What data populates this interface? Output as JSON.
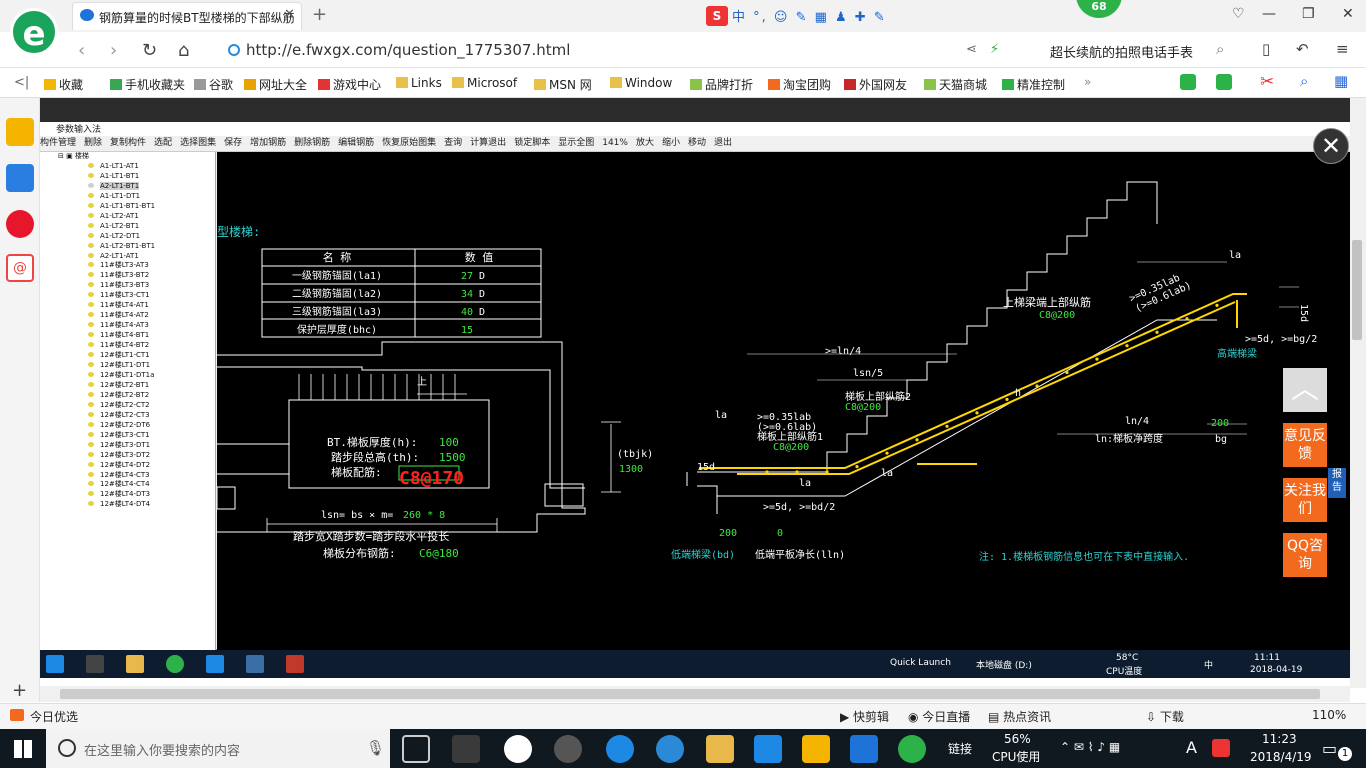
{
  "browser": {
    "tab_title": "钢筋算量的时候BT型楼梯的下部纵筋",
    "url": "http://e.fwxgx.com/question_1775307.html",
    "search_text": "超长续航的拍照电话手表",
    "notification_count": "68",
    "ime_text": "中 °,"
  },
  "bookmarks": [
    {
      "label": "收藏",
      "color": "#f2b705"
    },
    {
      "label": "手机收藏夹",
      "color": "#3aa655"
    },
    {
      "label": "谷歌",
      "color": "#999999"
    },
    {
      "label": "网址大全",
      "color": "#e8a300"
    },
    {
      "label": "游戏中心",
      "color": "#e33333"
    },
    {
      "label": "Links",
      "color": "#e8c04a"
    },
    {
      "label": "Microsof",
      "color": "#e8c04a"
    },
    {
      "label": "MSN 网",
      "color": "#e8c04a"
    },
    {
      "label": "Window",
      "color": "#e8c04a"
    },
    {
      "label": "品牌打折",
      "color": "#8bc34a"
    },
    {
      "label": "淘宝团购",
      "color": "#f36a1e"
    },
    {
      "label": "外国网友",
      "color": "#c62828"
    },
    {
      "label": "天猫商城",
      "color": "#8bc34a"
    },
    {
      "label": "精准控制",
      "color": "#2db24a"
    }
  ],
  "app": {
    "title": "参数输入法",
    "toolbar": [
      "构件管理",
      "删除",
      "复制构件",
      "选配",
      "选择图集",
      "保存",
      "增加钢筋",
      "删除钢筋",
      "编辑钢筋",
      "恢复原始图集",
      "查询",
      "计算退出",
      "锁定脚本",
      "显示全图",
      "141%",
      "放大",
      "缩小",
      "移动",
      "退出"
    ],
    "tree_root": "楼梯",
    "tree_items": [
      "A1-LT1-AT1",
      "A1-LT1-BT1",
      "A2-LT1-BT1",
      "A1-LT1-DT1",
      "A1-LT1-BT1-BT1",
      "A1-LT2-AT1",
      "A1-LT2-BT1",
      "A1-LT2-DT1",
      "A1-LT2-BT1-BT1",
      "A2-LT1-AT1",
      "11#楼LT3-AT3",
      "11#楼LT3-BT2",
      "11#楼LT3-BT3",
      "11#楼LT3-CT1",
      "11#楼LT4-AT1",
      "11#楼LT4-AT2",
      "11#楼LT4-AT3",
      "11#楼LT4-BT1",
      "11#楼LT4-BT2",
      "12#楼LT1-CT1",
      "12#楼LT1-DT1",
      "12#楼LT1-DT1a",
      "12#楼LT2-BT1",
      "12#楼LT2-BT2",
      "12#楼LT2-CT2",
      "12#楼LT2-CT3",
      "12#楼LT2-DT6",
      "12#楼LT3-CT1",
      "12#楼LT3-DT1",
      "12#楼LT3-DT2",
      "12#楼LT4-DT2",
      "12#楼LT4-CT3",
      "12#楼LT4-CT4",
      "12#楼LT4-DT3",
      "12#楼LT4-DT4"
    ],
    "selected_index": 2
  },
  "cad": {
    "heading": "型楼梯:",
    "table_headers": [
      "名 称",
      "数 值"
    ],
    "table_rows": [
      {
        "name": "一级钢筋锚固(la1)",
        "value": "27",
        "unit": "D"
      },
      {
        "name": "二级钢筋锚固(la2)",
        "value": "34",
        "unit": "D"
      },
      {
        "name": "三级钢筋锚固(la3)",
        "value": "40",
        "unit": "D"
      },
      {
        "name": "保护层厚度(bhc)",
        "value": "15",
        "unit": ""
      }
    ],
    "plan_labels": {
      "thickness_label": "BT.梯板厚度(h):",
      "thickness_value": "100",
      "height_label": "踏步段总高(th):",
      "height_value": "1500",
      "rebar_label": "梯板配筋:",
      "rebar_value": "C8@170",
      "tbjk": "(tbjk)",
      "tbjk_value": "1300",
      "lsn_label": "lsn= bs × m=",
      "lsn_value": "260 * 8",
      "step_desc": "踏步宽X踏步数=踏步段水平投长",
      "dist_label": "梯板分布钢筋:",
      "dist_value": "C6@180",
      "up": "上"
    },
    "section_labels": {
      "la": "la",
      "d15": "15d",
      "ln4a": ">=ln/4",
      "lsn5": "lsn/5",
      "lower_rebar2": "梯板上部纵筋2",
      "lower_rebar2_value": "C8@200",
      "anchor1": ">=0.35lab",
      "anchor2": "(>=0.6lab)",
      "lower_rebar1": "梯板上部纵筋1",
      "lower_rebar1_value": "C8@200",
      "d5": ">=5d, >=bd/2",
      "upper_title": "上梯梁端上部纵筋",
      "upper_value": "C8@200",
      "high_beam": "高端梯梁",
      "d5b": ">=5d, >=bg/2",
      "ln4": "ln/4",
      "ln_label": "ln:梯板净跨度",
      "bg_value": "200",
      "bg": "bg",
      "bd_value": "200",
      "lln_value": "0",
      "low_beam": "低端梯梁(bd)",
      "low_plate": "低端平板净长(lln)",
      "h": "h",
      "d15b": "15d",
      "note": "注: 1.楼梯板钢筋信息也可在下表中直接输入."
    }
  },
  "side_widgets": [
    "意见反馈",
    "关注我们",
    "QQ咨询"
  ],
  "report": "报告",
  "inner_taskbar": {
    "quick_launch": "Quick Launch",
    "disk": "本地磁盘 (D:)",
    "temp": "58°C",
    "temp_label": "CPU温度",
    "time": "11:11",
    "date": "2018-04-19",
    "ime": "中"
  },
  "statusbar": {
    "left": "今日优选",
    "items": [
      "快剪辑",
      "今日直播",
      "热点资讯",
      "下载"
    ],
    "zoom": "110%"
  },
  "taskbar": {
    "search_placeholder": "在这里输入你要搜索的内容",
    "link_label": "链接",
    "cpu_percent": "56%",
    "cpu_label": "CPU使用",
    "time": "11:23",
    "date": "2018/4/19",
    "lang": "A",
    "notify": "1"
  }
}
